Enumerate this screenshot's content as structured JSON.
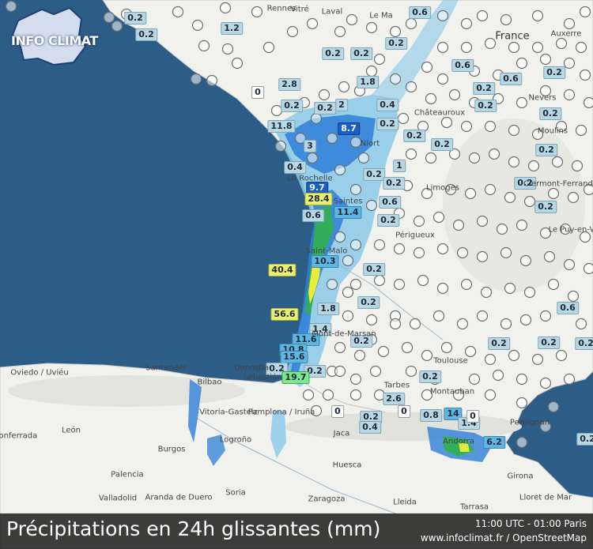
{
  "footer": {
    "title": "Précipitations en 24h glissantes (mm)",
    "time": "11:00 UTC - 01:00 Paris",
    "source": "www.infoclimat.fr / OpenStreetMap"
  },
  "logo": {
    "text": "INFO CLIMAT"
  },
  "colors": {
    "sea": "#2b5d87",
    "land": "#f1f1ee",
    "land_mountain": "#e7e7e1",
    "rain_light": "#89c9e8",
    "rain_mid": "#2e7fd8",
    "rain_heavy": "#32b04a",
    "rain_extreme": "#f3ef3a",
    "footer_bg": "#1a1a1a",
    "label_light": "#b9d7e3",
    "label_dark": "#1b5fc2",
    "label_green": "#7ee68e",
    "label_yellow": "#e9ef6e"
  },
  "places": [
    {
      "name": "France",
      "big": true
    },
    {
      "name": "Rennes"
    },
    {
      "name": "Vitré"
    },
    {
      "name": "Laval"
    },
    {
      "name": "Le Ma"
    },
    {
      "name": "Auxerre"
    },
    {
      "name": "Nevers"
    },
    {
      "name": "Moulins"
    },
    {
      "name": "Châteauroux"
    },
    {
      "name": "Limoges"
    },
    {
      "name": "Périgueux"
    },
    {
      "name": "Clermont-Ferrand"
    },
    {
      "name": "Le Puy-en-Velay"
    },
    {
      "name": "Montauban"
    },
    {
      "name": "Toulouse"
    },
    {
      "name": "Tarbes"
    },
    {
      "name": "Perpignan"
    },
    {
      "name": "Andorra"
    },
    {
      "name": "Santander"
    },
    {
      "name": "Oviedo / Uviéu"
    },
    {
      "name": "Bilbao"
    },
    {
      "name": "Vitoria-Gasteiz"
    },
    {
      "name": "Pamplona / Iruña"
    },
    {
      "name": "Logroño"
    },
    {
      "name": "Burgos"
    },
    {
      "name": "León"
    },
    {
      "name": "Palencia"
    },
    {
      "name": "Valladolid"
    },
    {
      "name": "Aranda de Duero"
    },
    {
      "name": "Soria"
    },
    {
      "name": "Zaragoza"
    },
    {
      "name": "Huesca"
    },
    {
      "name": "Jaca"
    },
    {
      "name": "Lleida"
    },
    {
      "name": "Girona"
    },
    {
      "name": "Saint-Malo"
    },
    {
      "name": "Mont-de-Marsan"
    },
    {
      "name": "Donostia"
    },
    {
      "name": "Sebastián"
    },
    {
      "name": "Ponferrada"
    },
    {
      "name": "Tarrasa"
    },
    {
      "name": "Lloret de Mar"
    },
    {
      "name": "Niort"
    },
    {
      "name": "La Rochelle"
    },
    {
      "name": "Saintes"
    }
  ],
  "stations": [
    {
      "v": "0.2",
      "s": "l"
    },
    {
      "v": "0.2",
      "s": "l"
    },
    {
      "v": "1.2",
      "s": "l"
    },
    {
      "v": "0.6",
      "s": "l"
    },
    {
      "v": "0.2",
      "s": "l"
    },
    {
      "v": "0.2",
      "s": "l"
    },
    {
      "v": "0.2",
      "s": "l"
    },
    {
      "v": "1.8",
      "s": "l"
    },
    {
      "v": "0.6",
      "s": "l"
    },
    {
      "v": "0.2",
      "s": "l"
    },
    {
      "v": "0.6",
      "s": "l"
    },
    {
      "v": "0.2",
      "s": "l"
    },
    {
      "v": "2.8",
      "s": "l"
    },
    {
      "v": "0",
      "s": "w"
    },
    {
      "v": "0.2",
      "s": "l"
    },
    {
      "v": "2",
      "s": "l"
    },
    {
      "v": "0.2",
      "s": "l"
    },
    {
      "v": "8.7",
      "s": "d"
    },
    {
      "v": "0.4",
      "s": "l"
    },
    {
      "v": "0.2",
      "s": "l"
    },
    {
      "v": "0.2",
      "s": "l"
    },
    {
      "v": "0.2",
      "s": "l"
    },
    {
      "v": "11.8",
      "s": "l"
    },
    {
      "v": "3",
      "s": "l"
    },
    {
      "v": "0.2",
      "s": "l"
    },
    {
      "v": "0.2",
      "s": "l"
    },
    {
      "v": "0.4",
      "s": "l"
    },
    {
      "v": "0.2",
      "s": "l"
    },
    {
      "v": "1",
      "s": "l"
    },
    {
      "v": "0.2",
      "s": "l"
    },
    {
      "v": "0.2",
      "s": "l"
    },
    {
      "v": "9.7",
      "s": "d"
    },
    {
      "v": "0.2",
      "s": "l"
    },
    {
      "v": "28.4",
      "s": "y"
    },
    {
      "v": "0.6",
      "s": "l"
    },
    {
      "v": "11.4",
      "s": "m"
    },
    {
      "v": "0.2",
      "s": "l"
    },
    {
      "v": "0.2",
      "s": "l"
    },
    {
      "v": "0.6",
      "s": "l"
    },
    {
      "v": "10.3",
      "s": "m"
    },
    {
      "v": "40.4",
      "s": "y"
    },
    {
      "v": "0.2",
      "s": "l"
    },
    {
      "v": "0.2",
      "s": "l"
    },
    {
      "v": "1.8",
      "s": "l"
    },
    {
      "v": "0.6",
      "s": "l"
    },
    {
      "v": "56.6",
      "s": "y"
    },
    {
      "v": "1.4",
      "s": "l"
    },
    {
      "v": "0.2",
      "s": "l"
    },
    {
      "v": "11.6",
      "s": "m"
    },
    {
      "v": "0.2",
      "s": "l"
    },
    {
      "v": "0.2",
      "s": "l"
    },
    {
      "v": "10.8",
      "s": "m"
    },
    {
      "v": "15.6",
      "s": "m"
    },
    {
      "v": "0.2",
      "s": "l"
    },
    {
      "v": "0.2",
      "s": "l"
    },
    {
      "v": "19.7",
      "s": "g"
    },
    {
      "v": "0.2",
      "s": "l"
    },
    {
      "v": "2.6",
      "s": "l"
    },
    {
      "v": "0",
      "s": "w"
    },
    {
      "v": "0.2",
      "s": "l"
    },
    {
      "v": "0",
      "s": "w"
    },
    {
      "v": "0.8",
      "s": "l"
    },
    {
      "v": "14",
      "s": "m"
    },
    {
      "v": "1.4",
      "s": "l"
    },
    {
      "v": "0.4",
      "s": "l"
    },
    {
      "v": "6.2",
      "s": "m"
    },
    {
      "v": "0",
      "s": "w"
    },
    {
      "v": "0.2",
      "s": "l"
    },
    {
      "v": "0.2",
      "s": "l"
    }
  ]
}
